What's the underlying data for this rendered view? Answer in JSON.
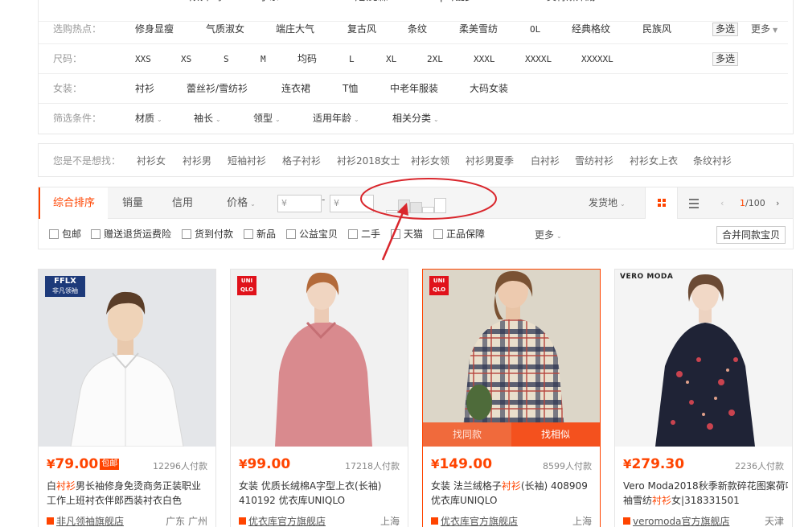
{
  "filters": {
    "brand_row": [
      "PEACEBIRD/太平鸟",
      "MG小象",
      "Oblithen/欧比森",
      "Rampo/乱步",
      "ZARA",
      "美特斯邦威",
      "ONLY"
    ],
    "hot_label": "选购热点：",
    "hot_items": [
      "修身显瘦",
      "气质淑女",
      "端庄大气",
      "复古风",
      "条纹",
      "柔美雪纺",
      "OL",
      "经典格纹",
      "民族风"
    ],
    "size_label": "尺码：",
    "size_items": [
      "XXS",
      "XS",
      "S",
      "M",
      "均码",
      "L",
      "XL",
      "2XL",
      "XXXL",
      "XXXXL",
      "XXXXXL"
    ],
    "women_label": "女装：",
    "women_items": [
      "衬衫",
      "蕾丝衫/雪纺衫",
      "连衣裙",
      "T恤",
      "中老年服装",
      "大码女装"
    ],
    "cond_label": "筛选条件：",
    "cond_items": [
      "材质",
      "袖长",
      "领型",
      "适用年龄",
      "相关分类"
    ],
    "multi_label": "多选",
    "more_label": "更多"
  },
  "suggest": {
    "label": "您是不是想找：",
    "items": [
      "衬衫女",
      "衬衫男",
      "短袖衬衫",
      "格子衬衫",
      "衬衫2018女士",
      "衬衫女领",
      "衬衫男夏季",
      "白衬衫",
      "雪纺衬衫",
      "衬衫女上衣",
      "条纹衬衫"
    ]
  },
  "sort": {
    "tabs": [
      "综合排序",
      "销量",
      "信用",
      "价格"
    ],
    "price_min_placeholder": "¥",
    "price_max_placeholder": "¥",
    "dash": "-",
    "histogram": [
      0.2,
      0.75,
      0.62,
      0.38,
      0.85
    ],
    "ship_from": "发货地",
    "page_current": "1",
    "page_total": "/100"
  },
  "checks": {
    "items": [
      "包邮",
      "赠送退货运费险",
      "货到付款",
      "新品",
      "公益宝贝",
      "二手",
      "天猫",
      "正品保障"
    ],
    "more": "更多",
    "merge": "合并同款宝贝"
  },
  "products": [
    {
      "brand": "FFLX",
      "brand_sub": "非凡领袖",
      "price": "79.00",
      "badge": "包邮",
      "sold": "12296人付款",
      "title_pre": "白",
      "title_hl": "衬衫",
      "title_post": "男长袖修身免烫商务正装职业",
      "title_line2": "工作上班衬衣伴郎西装衬衣白色",
      "shop": "非凡领袖旗舰店",
      "loc": "广东 广州"
    },
    {
      "brand": "UNI QLO",
      "price": "99.00",
      "sold": "17218人付款",
      "title_pre": "女装 优质长绒棉A字型上衣(长袖)",
      "title_hl": "",
      "title_post": "",
      "title_line2": "410192 优衣库UNIQLO",
      "shop": "优衣库官方旗舰店",
      "loc": "上海"
    },
    {
      "brand": "UNI QLO",
      "price": "149.00",
      "sold": "8599人付款",
      "title_pre": "女装 法兰绒格子",
      "title_hl": "衬衫",
      "title_post": "(长袖) 408909",
      "title_line2": "优衣库UNIQLO",
      "shop": "优衣库官方旗舰店",
      "loc": "上海",
      "find_same": "找同款",
      "find_similar": "找相似"
    },
    {
      "brand": "VERO MODA",
      "price": "279.30",
      "sold": "2236人付款",
      "title_pre": "Vero Moda2018秋季新款碎花图案荷叶",
      "title_hl": "",
      "title_post": "",
      "title_line2_pre": "袖雪纺",
      "title_line2_hl": "衬衫",
      "title_line2_post": "女|318331501",
      "shop": "veromoda官方旗舰店",
      "loc": "天津"
    }
  ],
  "colors": {
    "accent": "#ff4400",
    "annotation": "#d9262c"
  }
}
